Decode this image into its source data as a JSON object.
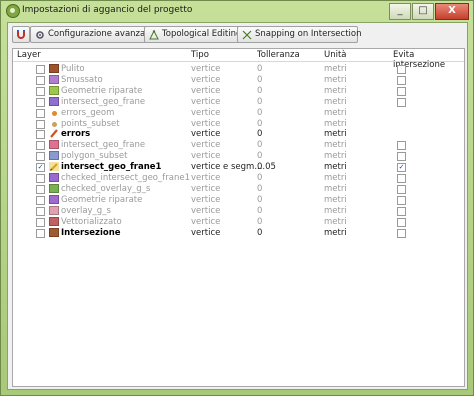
{
  "window": {
    "title": "Impostazioni di aggancio del progetto",
    "buttons": {
      "minimize": "_",
      "maximize": "□",
      "close": "X"
    }
  },
  "toolbar": {
    "advanced_label": "Configurazione avanzata",
    "topo_label": "Topological Editing",
    "snap_label": "Snapping on Intersection"
  },
  "table": {
    "headers": [
      "Layer",
      "Tipo",
      "Tolleranza",
      "Unità",
      "Evita intersezione"
    ],
    "rows": [
      {
        "name": "Pulito",
        "tipo": "vertice",
        "tol": "0",
        "unit": "metri",
        "checked": false,
        "avoid": false,
        "style": "dis",
        "swatch": "#a0522d",
        "swtype": "box"
      },
      {
        "name": "Smussato",
        "tipo": "vertice",
        "tol": "0",
        "unit": "metri",
        "checked": false,
        "avoid": false,
        "style": "dis",
        "swatch": "#b07fd0",
        "swtype": "box"
      },
      {
        "name": "Geometrie riparate",
        "tipo": "vertice",
        "tol": "0",
        "unit": "metri",
        "checked": false,
        "avoid": false,
        "style": "dis",
        "swatch": "#9dc84a",
        "swtype": "box"
      },
      {
        "name": "intersect_geo_frane",
        "tipo": "vertice",
        "tol": "0",
        "unit": "metri",
        "checked": false,
        "avoid": false,
        "style": "dis",
        "swatch": "#8e6fd0",
        "swtype": "box"
      },
      {
        "name": "errors_geom",
        "tipo": "vertice",
        "tol": "0",
        "unit": "metri",
        "checked": false,
        "avoid": null,
        "style": "dis",
        "swatch": "#e08a30",
        "swtype": "dot"
      },
      {
        "name": "points_subset",
        "tipo": "vertice",
        "tol": "0",
        "unit": "metri",
        "checked": false,
        "avoid": null,
        "style": "dis",
        "swatch": "#c8a060",
        "swtype": "dot"
      },
      {
        "name": "errors",
        "tipo": "vertice",
        "tol": "0",
        "unit": "metri",
        "checked": false,
        "avoid": null,
        "style": "bold",
        "swatch": "#d05020",
        "swtype": "line"
      },
      {
        "name": "intersect_geo_frane",
        "tipo": "vertice",
        "tol": "0",
        "unit": "metri",
        "checked": false,
        "avoid": false,
        "style": "dis",
        "swatch": "#e07090",
        "swtype": "box"
      },
      {
        "name": "polygon_subset",
        "tipo": "vertice",
        "tol": "0",
        "unit": "metri",
        "checked": false,
        "avoid": false,
        "style": "dis",
        "swatch": "#8a9ad0",
        "swtype": "box"
      },
      {
        "name": "intersect_geo_frane1",
        "tipo": "vertice e segm...",
        "tol": "0.05",
        "unit": "metri",
        "checked": true,
        "avoid": true,
        "style": "bold",
        "swatch": "#e0a020",
        "swtype": "edit"
      },
      {
        "name": "checked_intersect_geo_frane1",
        "tipo": "vertice",
        "tol": "0",
        "unit": "metri",
        "checked": false,
        "avoid": false,
        "style": "dis",
        "swatch": "#9a6ad0",
        "swtype": "box"
      },
      {
        "name": "checked_overlay_g_s",
        "tipo": "vertice",
        "tol": "0",
        "unit": "metri",
        "checked": false,
        "avoid": false,
        "style": "dis",
        "swatch": "#7ab050",
        "swtype": "box"
      },
      {
        "name": "Geometrie riparate",
        "tipo": "vertice",
        "tol": "0",
        "unit": "metri",
        "checked": false,
        "avoid": false,
        "style": "dis",
        "swatch": "#a06ad0",
        "swtype": "box"
      },
      {
        "name": "overlay_g_s",
        "tipo": "vertice",
        "tol": "0",
        "unit": "metri",
        "checked": false,
        "avoid": false,
        "style": "dis",
        "swatch": "#e0a0b0",
        "swtype": "box"
      },
      {
        "name": "Vettorializzato",
        "tipo": "vertice",
        "tol": "0",
        "unit": "metri",
        "checked": false,
        "avoid": false,
        "style": "dis",
        "swatch": "#c06060",
        "swtype": "box"
      },
      {
        "name": "Intersezione",
        "tipo": "vertice",
        "tol": "0",
        "unit": "metri",
        "checked": false,
        "avoid": false,
        "style": "bold",
        "swatch": "#a05a30",
        "swtype": "box"
      }
    ]
  }
}
